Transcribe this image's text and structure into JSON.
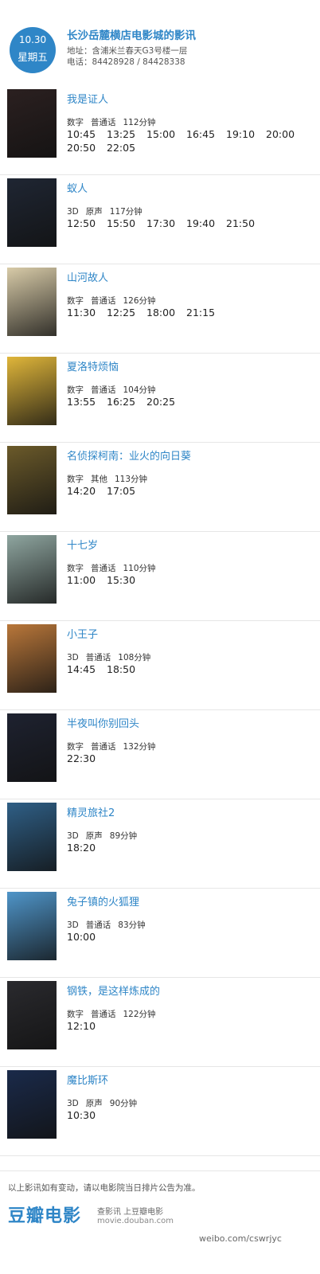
{
  "header": {
    "date": "10.30",
    "weekday": "星期五",
    "cinema_name": "长沙岳麓横店电影城的影讯",
    "address": "地址：含浦米兰春天G3号楼一层",
    "phone": "电话：84428928 / 84428338"
  },
  "movies": [
    {
      "title": "我是证人",
      "format": "数字",
      "language": "普通话",
      "duration": "112分钟",
      "times": [
        "10:45",
        "13:25",
        "15:00",
        "16:45",
        "19:10",
        "20:00",
        "20:50",
        "22:05"
      ],
      "poster_color": "#2b2020"
    },
    {
      "title": "蚁人",
      "format": "3D",
      "language": "原声",
      "duration": "117分钟",
      "times": [
        "12:50",
        "15:50",
        "17:30",
        "19:40",
        "21:50"
      ],
      "poster_color": "#1f2633"
    },
    {
      "title": "山河故人",
      "format": "数字",
      "language": "普通话",
      "duration": "126分钟",
      "times": [
        "11:30",
        "12:25",
        "18:00",
        "21:15"
      ],
      "poster_color": "#d8cba8"
    },
    {
      "title": "夏洛特烦恼",
      "format": "数字",
      "language": "普通话",
      "duration": "104分钟",
      "times": [
        "13:55",
        "16:25",
        "20:25"
      ],
      "poster_color": "#e0b63a"
    },
    {
      "title": "名侦探柯南：业火的向日葵",
      "format": "数字",
      "language": "其他",
      "duration": "113分钟",
      "times": [
        "14:20",
        "17:05"
      ],
      "poster_color": "#6b5a2a"
    },
    {
      "title": "十七岁",
      "format": "数字",
      "language": "普通话",
      "duration": "110分钟",
      "times": [
        "11:00",
        "15:30"
      ],
      "poster_color": "#8fa6a0"
    },
    {
      "title": "小王子",
      "format": "3D",
      "language": "普通话",
      "duration": "108分钟",
      "times": [
        "14:45",
        "18:50"
      ],
      "poster_color": "#b9773a"
    },
    {
      "title": "半夜叫你别回头",
      "format": "数字",
      "language": "普通话",
      "duration": "132分钟",
      "times": [
        "22:30"
      ],
      "poster_color": "#1e2230"
    },
    {
      "title": "精灵旅社2",
      "format": "3D",
      "language": "原声",
      "duration": "89分钟",
      "times": [
        "18:20"
      ],
      "poster_color": "#2f5f86"
    },
    {
      "title": "兔子镇的火狐狸",
      "format": "3D",
      "language": "普通话",
      "duration": "83分钟",
      "times": [
        "10:00"
      ],
      "poster_color": "#4f95c9"
    },
    {
      "title": "钢铁，是这样炼成的",
      "format": "数字",
      "language": "普通话",
      "duration": "122分钟",
      "times": [
        "12:10"
      ],
      "poster_color": "#2a2a2e"
    },
    {
      "title": "魔比斯环",
      "format": "3D",
      "language": "原声",
      "duration": "90分钟",
      "times": [
        "10:30"
      ],
      "poster_color": "#1a2a4a"
    }
  ],
  "footer": {
    "notice": "以上影讯如有变动，请以电影院当日排片公告为准。",
    "brand": "豆瓣电影",
    "links": "查影讯  上豆瓣电影",
    "url": "movie.douban.com",
    "weibo": "weibo.com/cswrjyc"
  },
  "colors": {
    "accent": "#2f86c7"
  }
}
